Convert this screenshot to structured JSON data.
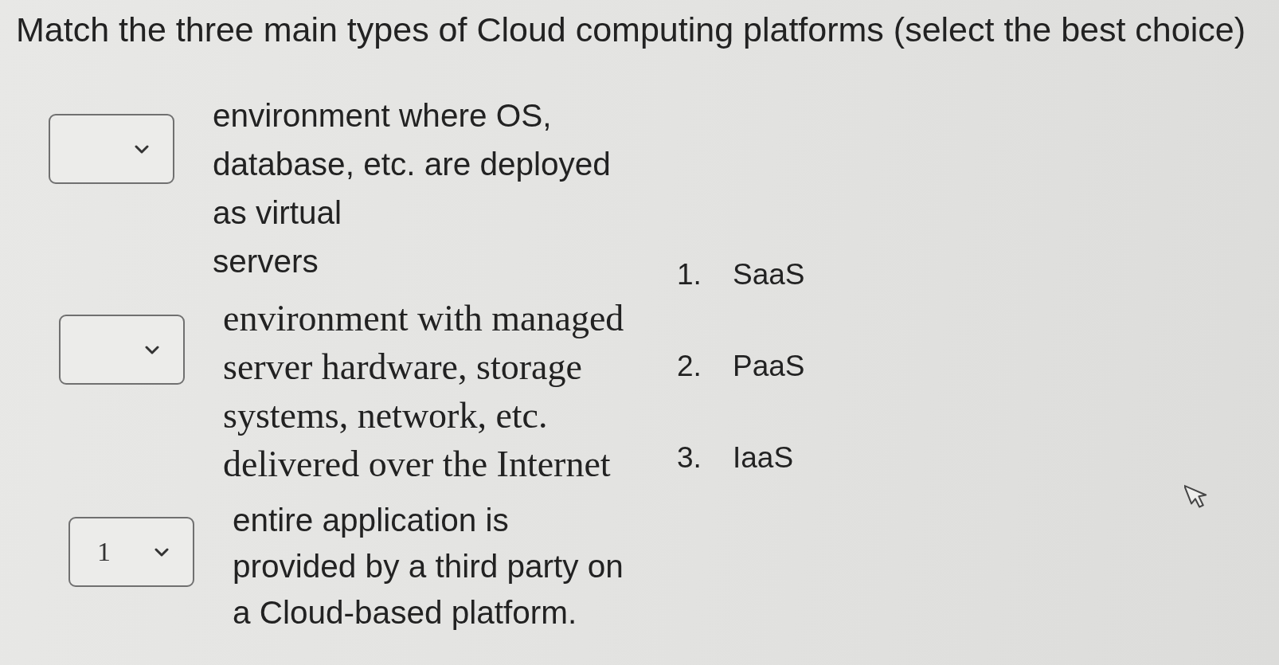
{
  "question": {
    "title": "Match the three main types of Cloud computing platforms (select the best choice)"
  },
  "matches": [
    {
      "kind": "sans-text",
      "description": "environment where OS,\ndatabase, etc. are deployed\nas virtual\nservers"
    },
    {
      "kind": "serif-text",
      "description": "environment with managed\nserver hardware, storage\nsystems, network, etc.\ndelivered over the Internet"
    },
    {
      "kind": "sans-text",
      "value": "1",
      "description": "entire application is\nprovided by a third party on\na Cloud-based platform."
    }
  ],
  "choices": [
    {
      "number": "1.",
      "label": "SaaS"
    },
    {
      "number": "2.",
      "label": "PaaS"
    },
    {
      "number": "3.",
      "label": "IaaS"
    }
  ]
}
